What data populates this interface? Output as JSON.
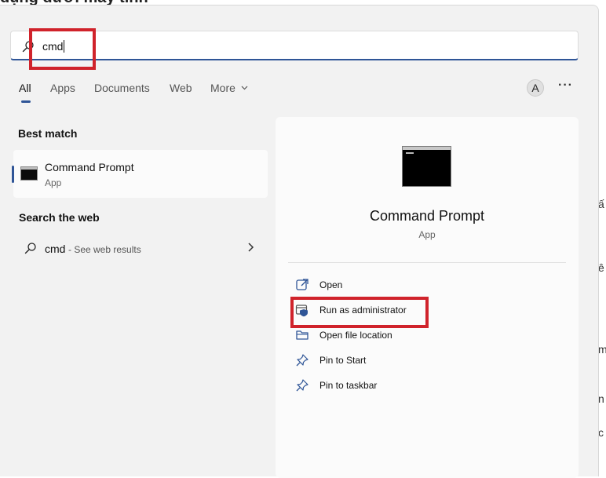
{
  "background": {
    "top_fragment": "dụng dưới máy tính",
    "edge_chars": [
      "ấ",
      "ê",
      "m",
      "n",
      "c"
    ]
  },
  "search": {
    "value": "cmd"
  },
  "tabs": [
    {
      "label": "All",
      "active": true
    },
    {
      "label": "Apps",
      "active": false
    },
    {
      "label": "Documents",
      "active": false
    },
    {
      "label": "Web",
      "active": false
    },
    {
      "label": "More",
      "active": false
    }
  ],
  "header": {
    "avatar_initial": "A",
    "more_options": "···"
  },
  "best_match": {
    "title": "Best match",
    "item": {
      "name": "Command Prompt",
      "type": "App",
      "icon": "command-prompt-icon"
    }
  },
  "web_search": {
    "title": "Search the web",
    "query": "cmd",
    "hint": "- See web results"
  },
  "preview": {
    "name": "Command Prompt",
    "type": "App",
    "actions": [
      {
        "label": "Open",
        "icon": "open-external-icon"
      },
      {
        "label": "Run as administrator",
        "icon": "shield-admin-icon"
      },
      {
        "label": "Open file location",
        "icon": "folder-icon"
      },
      {
        "label": "Pin to Start",
        "icon": "pin-icon"
      },
      {
        "label": "Pin to taskbar",
        "icon": "pin-icon"
      }
    ]
  },
  "colors": {
    "accent": "#2f5597",
    "highlight": "#d0232b",
    "panel": "#f2f2f2"
  }
}
